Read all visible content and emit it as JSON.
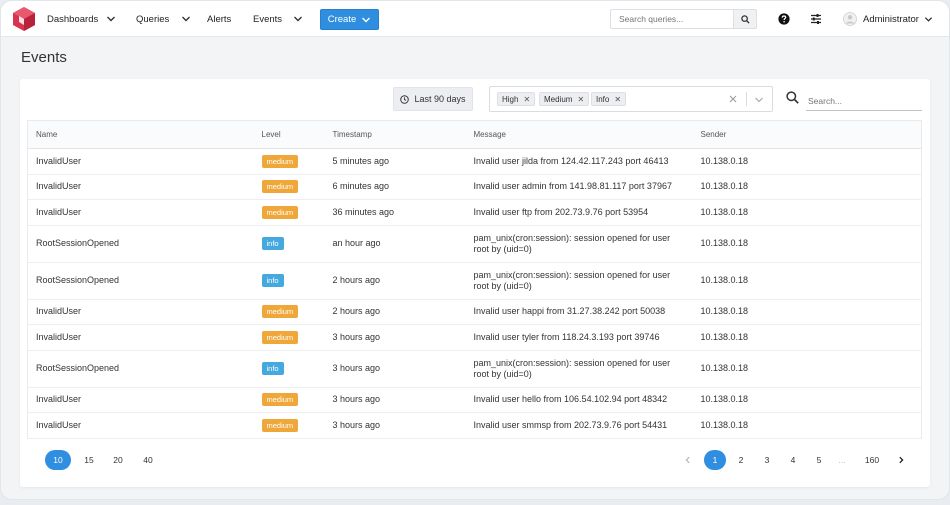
{
  "nav": {
    "items": [
      {
        "label": "Dashboards",
        "dropdown": true
      },
      {
        "label": "Queries",
        "dropdown": true
      },
      {
        "label": "Alerts",
        "dropdown": false
      },
      {
        "label": "Events",
        "dropdown": true
      }
    ],
    "create_label": "Create",
    "search_placeholder": "Search queries...",
    "user_name": "Administrator"
  },
  "colors": {
    "accent": "#2f8ee0",
    "medium": "#f0a73a",
    "info": "#45a8df",
    "logo": "#d9344f"
  },
  "page": {
    "title": "Events"
  },
  "filters": {
    "date_range": "Last 90 days",
    "tags": [
      "High",
      "Medium",
      "Info"
    ],
    "search_placeholder": "Search..."
  },
  "table": {
    "columns": [
      "Name",
      "Level",
      "Timestamp",
      "Message",
      "Sender"
    ],
    "rows": [
      {
        "name": "InvalidUser",
        "level": "medium",
        "timestamp": "5 minutes ago",
        "message": "Invalid user jilda from 124.42.117.243 port 46413",
        "message2": "",
        "sender": "10.138.0.18"
      },
      {
        "name": "InvalidUser",
        "level": "medium",
        "timestamp": "6 minutes ago",
        "message": "Invalid user admin from 141.98.81.117 port 37967",
        "message2": "",
        "sender": "10.138.0.18"
      },
      {
        "name": "InvalidUser",
        "level": "medium",
        "timestamp": "36 minutes ago",
        "message": "Invalid user ftp from 202.73.9.76 port 53954",
        "message2": "",
        "sender": "10.138.0.18"
      },
      {
        "name": "RootSessionOpened",
        "level": "info",
        "timestamp": "an hour ago",
        "message": "pam_unix(cron:session): session opened for user",
        "message2": "root by (uid=0)",
        "sender": "10.138.0.18"
      },
      {
        "name": "RootSessionOpened",
        "level": "info",
        "timestamp": "2 hours ago",
        "message": "pam_unix(cron:session): session opened for user",
        "message2": "root by (uid=0)",
        "sender": "10.138.0.18"
      },
      {
        "name": "InvalidUser",
        "level": "medium",
        "timestamp": "2 hours ago",
        "message": "Invalid user happi from 31.27.38.242 port 50038",
        "message2": "",
        "sender": "10.138.0.18"
      },
      {
        "name": "InvalidUser",
        "level": "medium",
        "timestamp": "3 hours ago",
        "message": "Invalid user tyler from 118.24.3.193 port 39746",
        "message2": "",
        "sender": "10.138.0.18"
      },
      {
        "name": "RootSessionOpened",
        "level": "info",
        "timestamp": "3 hours ago",
        "message": "pam_unix(cron:session): session opened for user",
        "message2": "root by (uid=0)",
        "sender": "10.138.0.18"
      },
      {
        "name": "InvalidUser",
        "level": "medium",
        "timestamp": "3 hours ago",
        "message": "Invalid user hello from 106.54.102.94 port 48342",
        "message2": "",
        "sender": "10.138.0.18"
      },
      {
        "name": "InvalidUser",
        "level": "medium",
        "timestamp": "3 hours ago",
        "message": "Invalid user smmsp from 202.73.9.76 port 54431",
        "message2": "",
        "sender": "10.138.0.18"
      }
    ]
  },
  "pagination": {
    "page_sizes": [
      "10",
      "15",
      "20",
      "40"
    ],
    "active_page_size": "10",
    "pages": [
      "1",
      "2",
      "3",
      "4",
      "5"
    ],
    "active_page": "1",
    "ellipsis": "...",
    "last_page": "160"
  }
}
